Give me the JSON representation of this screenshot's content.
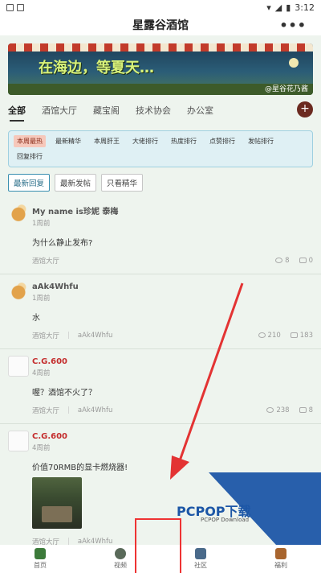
{
  "status": {
    "time": "3:12"
  },
  "title": "星露谷酒馆",
  "more": "•••",
  "banner": {
    "headline": "在海边，等夏天…",
    "caption": "@星谷花乃酱"
  },
  "tabs": [
    "全部",
    "酒馆大厅",
    "藏宝阁",
    "技术协会",
    "办公室"
  ],
  "tabs_active": 0,
  "add": "+",
  "rankings": [
    "本周最热",
    "最新精华",
    "本周肝王",
    "大佬排行",
    "热度排行",
    "点赞排行",
    "发帖排行",
    "回复排行"
  ],
  "rankings_active": 0,
  "filters": [
    "最新回复",
    "最新发帖",
    "只看精华"
  ],
  "filters_active": 0,
  "posts": [
    {
      "author": "My name is珍妮 泰梅",
      "time": "1周前",
      "content": "为什么静止发布?",
      "board": "酒馆大厅",
      "views": "8",
      "comments": "0"
    },
    {
      "author": "aAk4Whfu",
      "time": "1周前",
      "content": "水",
      "board": "酒馆大厅",
      "user": "aAk4Whfu",
      "views": "210",
      "comments": "183"
    },
    {
      "author": "C.G.600",
      "time": "4周前",
      "content": "喔？酒馆不火了？",
      "board": "酒馆大厅",
      "user": "aAk4Whfu",
      "views": "238",
      "comments": "8"
    },
    {
      "author": "C.G.600",
      "time": "4周前",
      "content": "价值70RMB的显卡燃烧器!",
      "board": "酒馆大厅",
      "user": "aAk4Whfu"
    }
  ],
  "nav": [
    "首页",
    "视频",
    "社区",
    "福利"
  ],
  "nav_active": 2,
  "watermark": {
    "logo": "PCPOP下载",
    "sub": "PCPOP Download"
  },
  "colors": {
    "accent": "#6b2a20",
    "highlight": "#e33333",
    "rank_active_bg": "#f6c8bb"
  }
}
